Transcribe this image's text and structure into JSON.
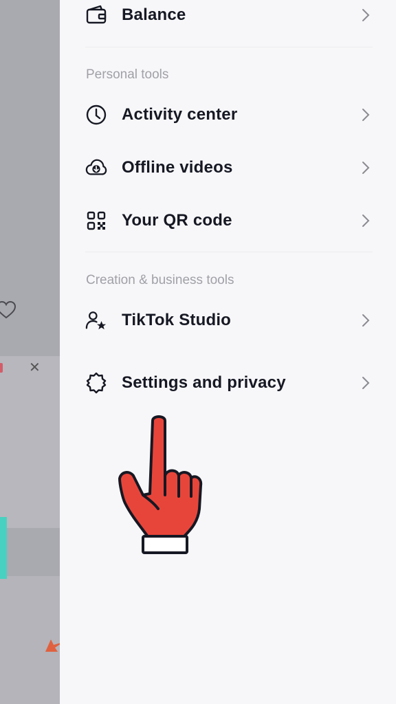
{
  "menu": {
    "balance": {
      "label": "Balance",
      "icon": "wallet-icon"
    },
    "personal_tools_header": "Personal tools",
    "activity_center": {
      "label": "Activity center",
      "icon": "clock-icon"
    },
    "offline_videos": {
      "label": "Offline videos",
      "icon": "cloud-download-icon"
    },
    "qr_code": {
      "label": "Your QR code",
      "icon": "qr-code-icon"
    },
    "creation_tools_header": "Creation & business tools",
    "tiktok_studio": {
      "label": "TikTok Studio",
      "icon": "user-star-icon"
    },
    "settings": {
      "label": "Settings and privacy",
      "icon": "gear-icon"
    }
  },
  "overlay": {
    "icon": "pointing-hand-icon",
    "color": "#e8453a"
  }
}
